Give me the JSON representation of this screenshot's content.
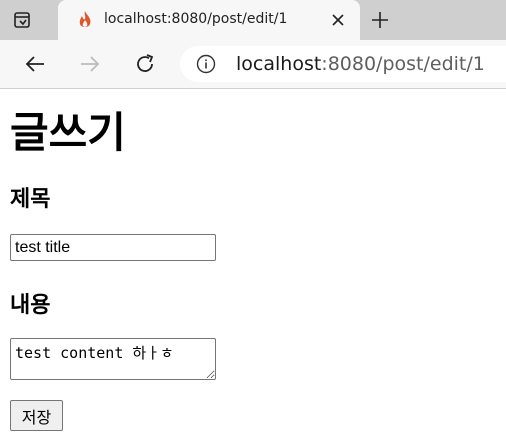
{
  "browser": {
    "tab": {
      "title": "localhost:8080/post/edit/1",
      "favicon": "flame-icon"
    },
    "address": {
      "host": "localhost",
      "path": ":8080/post/edit/1"
    }
  },
  "page": {
    "heading": "글쓰기",
    "title_label": "제목",
    "title_value": "test title",
    "content_label": "내용",
    "content_value": "test content 하ㅏㅎ",
    "save_label": "저장"
  },
  "colors": {
    "tabbar": "#cfcfcf",
    "toolbar": "#f7f7f7",
    "flame": "#e2552a"
  }
}
